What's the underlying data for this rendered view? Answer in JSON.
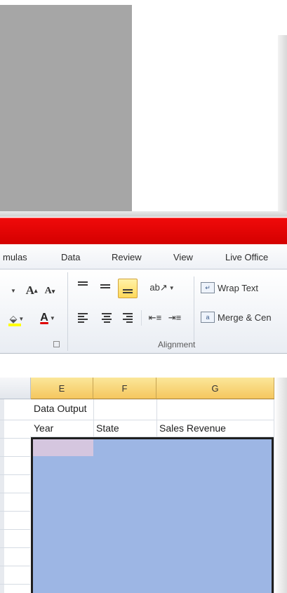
{
  "ribbon_tabs": [
    "mulas",
    "Data",
    "Review",
    "View",
    "Live Office"
  ],
  "ribbon": {
    "font_grow": "A",
    "font_shrink": "A",
    "font_color": "A",
    "wrap_text": "Wrap Text",
    "merge_center": "Merge & Cen",
    "alignment_group": "Alignment"
  },
  "columns": [
    "E",
    "F",
    "G"
  ],
  "cells": {
    "e_row1": "Data Output",
    "e_row2": "Year",
    "f_row2": "State",
    "g_row2": "Sales Revenue"
  },
  "colors": {
    "title_bar": "#e00000",
    "selection": "#9db6e4",
    "active_cell": "#d5c6df",
    "column_header_selected": "#f8d77a"
  }
}
